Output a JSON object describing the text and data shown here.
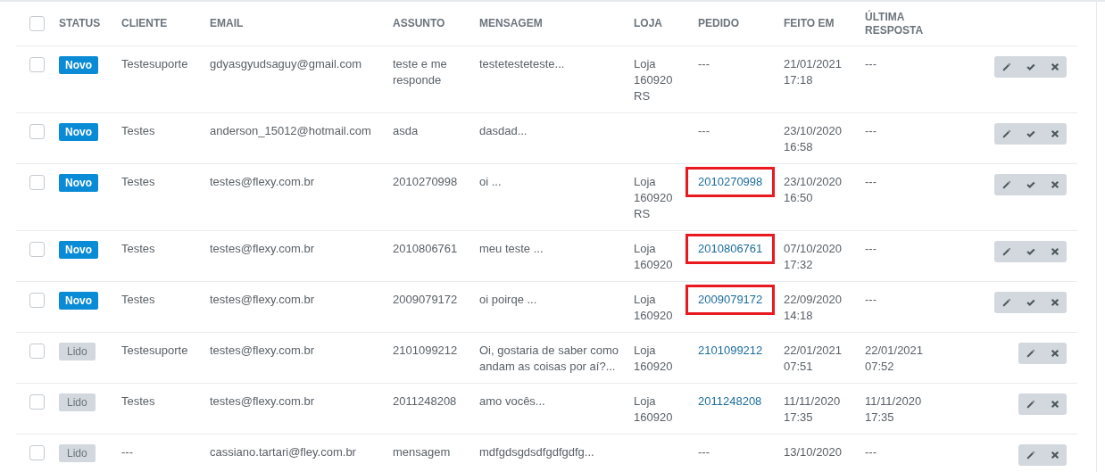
{
  "table": {
    "select_all": {
      "checked": false
    },
    "columns": [
      "STATUS",
      "CLIENTE",
      "EMAIL",
      "ASSUNTO",
      "MENSAGEM",
      "LOJA",
      "PEDIDO",
      "FEITO EM",
      "ÚLTIMA RESPOSTA"
    ],
    "rows": [
      {
        "checked": false,
        "status": {
          "label": "Novo",
          "kind": "new"
        },
        "cliente": "Testesuporte",
        "email": "gdyasgyudsaguy@gmail.com",
        "assunto": "teste e me responde",
        "mensagem": "testetesteteste...",
        "loja": "Loja 160920 RS",
        "pedido": {
          "text": "---",
          "link": false,
          "highlighted": false
        },
        "feito_em": "21/01/2021 17:18",
        "ultima_resposta": "---",
        "actions": [
          {
            "kind": "edit"
          },
          {
            "kind": "check"
          },
          {
            "kind": "delete"
          }
        ]
      },
      {
        "checked": false,
        "status": {
          "label": "Novo",
          "kind": "new"
        },
        "cliente": "Testes",
        "email": "anderson_15012@hotmail.com",
        "assunto": "asda",
        "mensagem": "dasdad...",
        "pedido": {
          "text": "---",
          "link": false,
          "highlighted": false
        },
        "feito_em": "23/10/2020 16:58",
        "ultima_resposta": "---",
        "actions": [
          {
            "kind": "edit"
          },
          {
            "kind": "check"
          },
          {
            "kind": "delete"
          }
        ]
      },
      {
        "checked": false,
        "status": {
          "label": "Novo",
          "kind": "new"
        },
        "cliente": "Testes",
        "email": "testes@flexy.com.br",
        "assunto": "2010270998",
        "mensagem": "oi ...",
        "loja": "Loja 160920 RS",
        "pedido": {
          "text": "2010270998",
          "link": true,
          "highlighted": true
        },
        "feito_em": "23/10/2020 16:50",
        "ultima_resposta": "---",
        "actions": [
          {
            "kind": "edit"
          },
          {
            "kind": "check"
          },
          {
            "kind": "delete"
          }
        ]
      },
      {
        "checked": false,
        "status": {
          "label": "Novo",
          "kind": "new"
        },
        "cliente": "Testes",
        "email": "testes@flexy.com.br",
        "assunto": "2010806761",
        "mensagem": "meu teste ...",
        "loja": "Loja 160920",
        "pedido": {
          "text": "2010806761",
          "link": true,
          "highlighted": true
        },
        "feito_em": "07/10/2020 17:32",
        "ultima_resposta": "---",
        "actions": [
          {
            "kind": "edit"
          },
          {
            "kind": "check"
          },
          {
            "kind": "delete"
          }
        ]
      },
      {
        "checked": false,
        "status": {
          "label": "Novo",
          "kind": "new"
        },
        "cliente": "Testes",
        "email": "testes@flexy.com.br",
        "assunto": "2009079172",
        "mensagem": "oi poirqe ...",
        "loja": "Loja 160920",
        "pedido": {
          "text": "2009079172",
          "link": true,
          "highlighted": true
        },
        "feito_em": "22/09/2020 14:18",
        "ultima_resposta": "---",
        "actions": [
          {
            "kind": "edit"
          },
          {
            "kind": "check"
          },
          {
            "kind": "delete"
          }
        ]
      },
      {
        "checked": false,
        "status": {
          "label": "Lido",
          "kind": "read"
        },
        "cliente": "Testesuporte",
        "email": "testes@flexy.com.br",
        "assunto": "2101099212",
        "mensagem": "Oi, gostaria de saber como andam as coisas por aí?...",
        "loja": "Loja 160920",
        "pedido": {
          "text": "2101099212",
          "link": true,
          "highlighted": false
        },
        "feito_em": "22/01/2021 07:51",
        "ultima_resposta": "22/01/2021 07:52",
        "actions": [
          {
            "kind": "edit"
          },
          {
            "kind": "delete"
          }
        ]
      },
      {
        "checked": false,
        "status": {
          "label": "Lido",
          "kind": "read"
        },
        "cliente": "Testes",
        "email": "testes@flexy.com.br",
        "assunto": "2011248208",
        "mensagem": "amo vocês...",
        "loja": "Loja 160920",
        "pedido": {
          "text": "2011248208",
          "link": true,
          "highlighted": false
        },
        "feito_em": "11/11/2020 17:35",
        "ultima_resposta": "11/11/2020 17:35",
        "actions": [
          {
            "kind": "edit"
          },
          {
            "kind": "delete"
          }
        ]
      },
      {
        "checked": false,
        "status": {
          "label": "Lido",
          "kind": "read"
        },
        "cliente": "---",
        "email": "cassiano.tartari@fley.com.br",
        "assunto": "mensagem",
        "mensagem": "mdfgdsgdsdfgdfgdfg...",
        "pedido": {
          "text": "---",
          "link": false,
          "highlighted": false
        },
        "feito_em": "13/10/2020",
        "ultima_resposta": "---",
        "actions": [
          {
            "kind": "edit"
          },
          {
            "kind": "delete"
          }
        ]
      }
    ]
  }
}
